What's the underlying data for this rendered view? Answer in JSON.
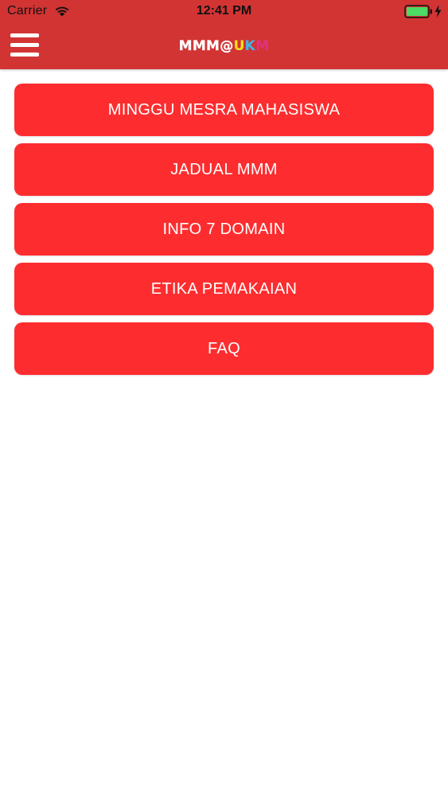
{
  "status_bar": {
    "carrier": "Carrier",
    "time": "12:41 PM",
    "battery_color": "#4cd964"
  },
  "header": {
    "background_color": "#d23434",
    "logo": {
      "prefix": "MMM@",
      "u": "U",
      "k": "K",
      "m": "M"
    },
    "menu_icon": "hamburger-icon"
  },
  "menu": {
    "button_color": "#fd2d2f",
    "items": [
      {
        "label": "MINGGU MESRA MAHASISWA"
      },
      {
        "label": "JADUAL MMM"
      },
      {
        "label": "INFO 7 DOMAIN"
      },
      {
        "label": "ETIKA PEMAKAIAN"
      },
      {
        "label": "FAQ"
      }
    ]
  }
}
